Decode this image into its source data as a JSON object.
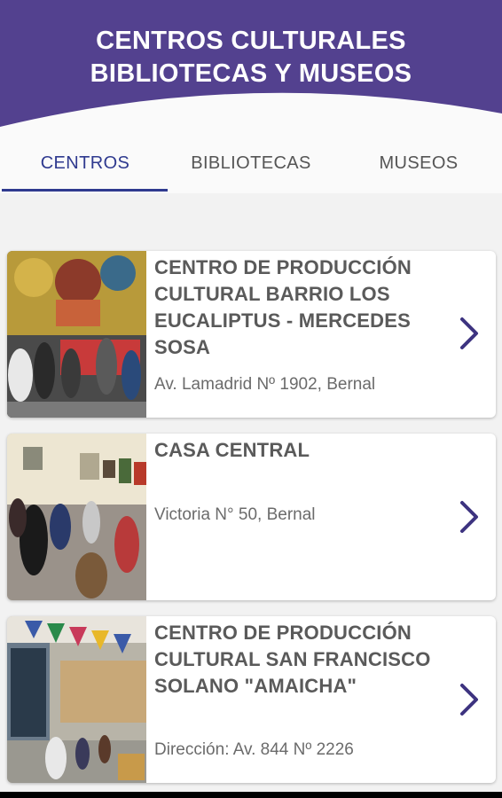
{
  "header": {
    "title_line1": "CENTROS CULTURALES",
    "title_line2": "BIBLIOTECAS Y MUSEOS"
  },
  "tabs": [
    {
      "label": "CENTROS",
      "active": true
    },
    {
      "label": "BIBLIOTECAS",
      "active": false
    },
    {
      "label": "MUSEOS",
      "active": false
    }
  ],
  "colors": {
    "header": "#53418f",
    "accent": "#2f3a8f",
    "chevron": "#3d3380"
  },
  "items": [
    {
      "name": "CENTRO DE PRODUCCIÓN CULTURAL BARRIO LOS EUCALIPTUS - MERCEDES SOSA",
      "address": "Av. Lamadrid Nº 1902, Bernal",
      "icon": "chevron-right-icon"
    },
    {
      "name": "CASA CENTRAL",
      "address": "Victoria N° 50, Bernal",
      "icon": "chevron-right-icon"
    },
    {
      "name": "CENTRO DE PRODUCCIÓN CULTURAL SAN FRANCISCO SOLANO \"AMAICHA\"",
      "address": "Dirección: Av. 844 Nº 2226",
      "icon": "chevron-right-icon"
    }
  ]
}
